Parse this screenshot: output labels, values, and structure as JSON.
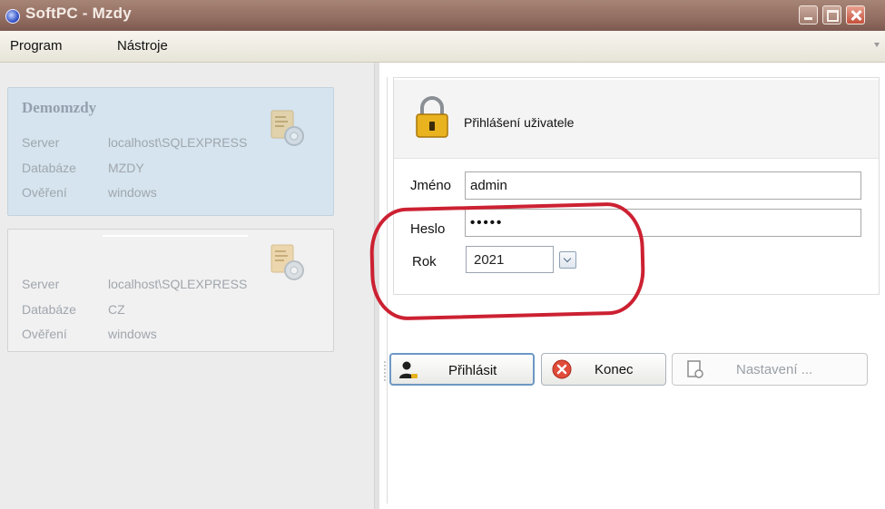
{
  "window": {
    "title": "SoftPC - Mzdy"
  },
  "menu": {
    "program": "Program",
    "tools": "Nástroje"
  },
  "databases": [
    {
      "title": "Demomzdy",
      "server_label": "Server",
      "server": "localhost\\SQLEXPRESS",
      "db_label": "Databáze",
      "db": "MZDY",
      "auth_label": "Ověření",
      "auth": "windows"
    },
    {
      "title": "",
      "server_label": "Server",
      "server": "localhost\\SQLEXPRESS",
      "db_label": "Databáze",
      "db": "CZ",
      "auth_label": "Ověření",
      "auth": "windows"
    }
  ],
  "login": {
    "title": "Přihlášení uživatele",
    "name_label": "Jméno",
    "name_value": "admin",
    "password_label": "Heslo",
    "password_value": "•••••",
    "year_label": "Rok",
    "year_value": "2021"
  },
  "buttons": {
    "login": "Přihlásit",
    "end": "Konec",
    "settings": "Nastavení ..."
  },
  "colors": {
    "highlight": "#cc2132",
    "selected_card": "#d5e4ee",
    "titlebar": "#946f63"
  }
}
